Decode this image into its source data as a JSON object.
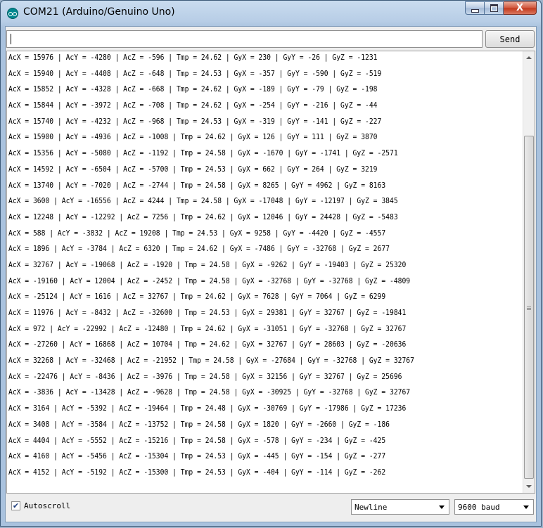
{
  "window": {
    "title": "COM21 (Arduino/Genuino Uno)",
    "minimize_glyph": "",
    "maximize_glyph": "",
    "close_glyph": "X"
  },
  "input": {
    "value": "",
    "send_label": "Send"
  },
  "output": {
    "lines": [
      "AcX = 15976 | AcY = -4280 | AcZ = -596 | Tmp = 24.62 | GyX = 230 | GyY = -26 | GyZ = -1231",
      "AcX = 15940 | AcY = -4408 | AcZ = -648 | Tmp = 24.53 | GyX = -357 | GyY = -590 | GyZ = -519",
      "AcX = 15852 | AcY = -4328 | AcZ = -668 | Tmp = 24.62 | GyX = -189 | GyY = -79 | GyZ = -198",
      "AcX = 15844 | AcY = -3972 | AcZ = -708 | Tmp = 24.62 | GyX = -254 | GyY = -216 | GyZ = -44",
      "AcX = 15740 | AcY = -4232 | AcZ = -968 | Tmp = 24.53 | GyX = -319 | GyY = -141 | GyZ = -227",
      "AcX = 15900 | AcY = -4936 | AcZ = -1008 | Tmp = 24.62 | GyX = 126 | GyY = 111 | GyZ = 3870",
      "AcX = 15356 | AcY = -5080 | AcZ = -1192 | Tmp = 24.58 | GyX = -1670 | GyY = -1741 | GyZ = -2571",
      "AcX = 14592 | AcY = -6504 | AcZ = -5700 | Tmp = 24.53 | GyX = 662 | GyY = 264 | GyZ = 3219",
      "AcX = 13740 | AcY = -7020 | AcZ = -2744 | Tmp = 24.58 | GyX = 8265 | GyY = 4962 | GyZ = 8163",
      "AcX = 3600 | AcY = -16556 | AcZ = 4244 | Tmp = 24.58 | GyX = -17048 | GyY = -12197 | GyZ = 3845",
      "AcX = 12248 | AcY = -12292 | AcZ = 7256 | Tmp = 24.62 | GyX = 12046 | GyY = 24428 | GyZ = -5483",
      "AcX = 588 | AcY = -3832 | AcZ = 19208 | Tmp = 24.53 | GyX = 9258 | GyY = -4420 | GyZ = -4557",
      "AcX = 1896 | AcY = -3784 | AcZ = 6320 | Tmp = 24.62 | GyX = -7486 | GyY = -32768 | GyZ = 2677",
      "AcX = 32767 | AcY = -19068 | AcZ = -1920 | Tmp = 24.58 | GyX = -9262 | GyY = -19403 | GyZ = 25320",
      "AcX = -19160 | AcY = 12004 | AcZ = -2452 | Tmp = 24.58 | GyX = -32768 | GyY = -32768 | GyZ = -4809",
      "AcX = -25124 | AcY = 1616 | AcZ = 32767 | Tmp = 24.62 | GyX = 7628 | GyY = 7064 | GyZ = 6299",
      "AcX = 11976 | AcY = -8432 | AcZ = -32600 | Tmp = 24.53 | GyX = 29381 | GyY = 32767 | GyZ = -19841",
      "AcX = 972 | AcY = -22992 | AcZ = -12480 | Tmp = 24.62 | GyX = -31051 | GyY = -32768 | GyZ = 32767",
      "AcX = -27260 | AcY = 16868 | AcZ = 10704 | Tmp = 24.62 | GyX = 32767 | GyY = 28603 | GyZ = -20636",
      "AcX = 32268 | AcY = -32468 | AcZ = -21952 | Tmp = 24.58 | GyX = -27684 | GyY = -32768 | GyZ = 32767",
      "AcX = -22476 | AcY = -8436 | AcZ = -3976 | Tmp = 24.58 | GyX = 32156 | GyY = 32767 | GyZ = 25696",
      "AcX = -3836 | AcY = -13428 | AcZ = -9628 | Tmp = 24.58 | GyX = -30925 | GyY = -32768 | GyZ = 32767",
      "AcX = 3164 | AcY = -5392 | AcZ = -19464 | Tmp = 24.48 | GyX = -30769 | GyY = -17986 | GyZ = 17236",
      "AcX = 3408 | AcY = -3584 | AcZ = -13752 | Tmp = 24.58 | GyX = 1820 | GyY = -2660 | GyZ = -186",
      "AcX = 4404 | AcY = -5552 | AcZ = -15216 | Tmp = 24.58 | GyX = -578 | GyY = -234 | GyZ = -425",
      "AcX = 4160 | AcY = -5456 | AcZ = -15304 | Tmp = 24.53 | GyX = -445 | GyY = -154 | GyZ = -277",
      "AcX = 4152 | AcY = -5192 | AcZ = -15300 | Tmp = 24.53 | GyX = -404 | GyY = -114 | GyZ = -262"
    ]
  },
  "footer": {
    "autoscroll_label": "Autoscroll",
    "autoscroll_checked": true,
    "line_ending": "Newline",
    "baud_rate": "9600 baud"
  },
  "colors": {
    "app_icon": "#00878f",
    "close_button": "#c2381c"
  },
  "icons": {
    "app": "arduino-logo-icon",
    "check": "checkmark-icon"
  }
}
